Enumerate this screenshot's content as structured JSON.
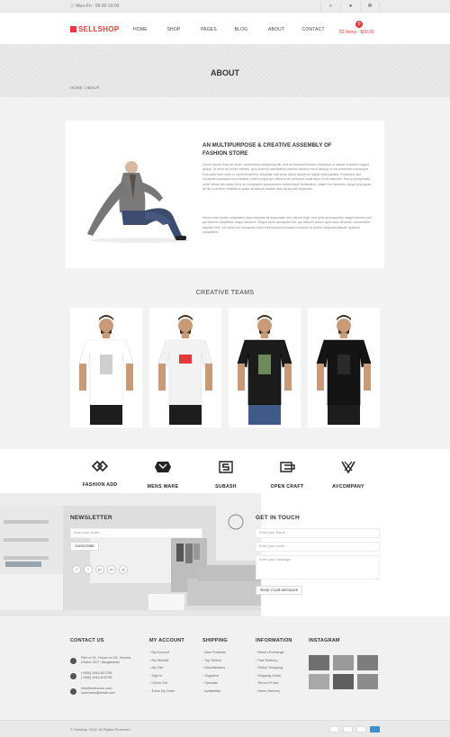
{
  "topbar": {
    "hours": "ⓒ Mon-Fri : 09:00-19:00",
    "icons": [
      "search-icon",
      "user-icon",
      "gear-icon"
    ]
  },
  "brand_name": "SELLSHOP",
  "nav": [
    "HOME",
    "SHOP",
    "PAGES",
    "BLOG",
    "ABOUT",
    "CONTACT"
  ],
  "cart": {
    "count": "0",
    "text": "02 Items : $60.00"
  },
  "page": {
    "title": "ABOUT",
    "breadcrumb": "HOME  /  ABOUT"
  },
  "about": {
    "heading": "AN MULTIPURPOSE & CREATIVE ASSEMBLY OF FASHION STORE",
    "para1": "Lorem ipsum dolor sit amet, consectetur adipisicing elit, sed do eiusmod tempor incididunt ut labore et dolore magna aliqua. Ut enim ad minim veniam, quis nostrud exercitation ullamco laboris nisi ut aliquip ex ea commodo consequat. Duis aute irure dolor in reprehenderit in voluptate velit esse cillum dolore eu fugiat nulla pariatur. Excepteur sint occaecat cupidatat non proident, sunt in culpa qui officia in be deserunt mollit anim id est laborum. Sed ut perspiciatis unde omnis iste natus error sit voluptatem accusantium doloremque laudantium, totam rem aperiam, eaque ipsa quae ab illo inventore veritatis et quasi architecto beatae vitae dicta sunt explicabo.",
    "para2": "Nemo enim ipsam voluptatem quia voluptas sit aspernatur aut odit aut fugit, sed quia consequuntur magni dolores eos qui ratione voluptatem sequi nesciunt. Neque porro quisquam est, qui dolorem ipsum quia dolor sit amet, consectetur, adipisci velit, sed quia non numquam eius modi tempora incidunt ut labore et dolore magnam aliquam quaerat voluptatem."
  },
  "teams": {
    "title": "CREATIVE TEAMS",
    "members": [
      {
        "shirt": "#ffffff",
        "print": "#cfcfcf"
      },
      {
        "shirt": "#f2f2f2",
        "print": "#e23b3b"
      },
      {
        "shirt": "#1b1b1b",
        "print": "#6c8a5a"
      },
      {
        "shirt": "#141414",
        "print": "#2a2a2a"
      }
    ]
  },
  "brands": [
    "FASHION ADD",
    "MENS WARE",
    "SUBASH",
    "OPEN CRAFT",
    "AVCOMPANY"
  ],
  "newsletter": {
    "title": "NEWSLETTER",
    "placeholder": "Enter your email...",
    "button": "SUBSCRIBE",
    "social": [
      "f",
      "t",
      "g+",
      "in",
      "yt"
    ]
  },
  "contact_form": {
    "title": "GET IN TOUCH",
    "name": "Enter your Name...",
    "email": "Enter your email...",
    "message": "Enter your message...",
    "button": "SEND YOUR MESSAGE"
  },
  "footer": {
    "contact": {
      "title": "CONTACT US",
      "address": [
        "Flat no 01, House no 02, Vincent,",
        "Dhaka 1207, Bangladesh"
      ],
      "phones": [
        "(+880) 1943-821758",
        "(+880) 1943-815758"
      ],
      "emails": [
        "info@motionzin.com",
        "username@email.com"
      ]
    },
    "account": {
      "title": "MY ACCOUNT",
      "items": [
        "My Account",
        "My Wishlist",
        "My Cart",
        "Sign In",
        "Check Out",
        "Track My Order"
      ]
    },
    "shipping": {
      "title": "SHIPPING",
      "items": [
        "New Products",
        "Top Sellers",
        "Manufactirers",
        "Suppliers",
        "Specials",
        "Availability"
      ]
    },
    "information": {
      "title": "INFORMATION",
      "items": [
        "Return Exchange",
        "Fast Delivery",
        "Online Shopping",
        "Shipping Guide",
        "Terms Of Use",
        "Home Delivery"
      ]
    },
    "instagram": {
      "title": "INSTAGRAM"
    },
    "copyright": "© Sellshop 2016. All Rights Reserved",
    "payments": [
      "PayPal",
      "Mastercard",
      "VISA",
      "Amex"
    ]
  }
}
